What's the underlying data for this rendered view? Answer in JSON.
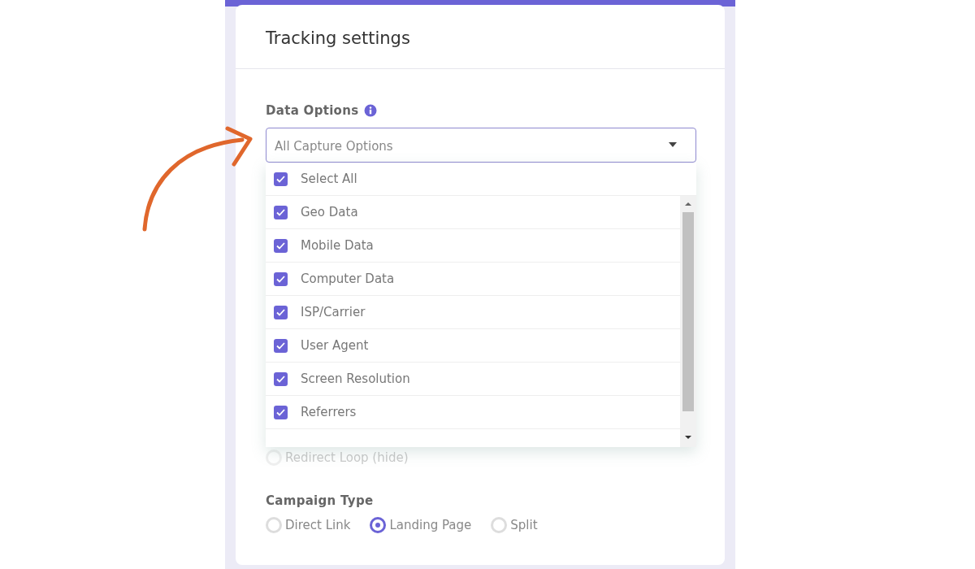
{
  "panel": {
    "title": "Tracking settings"
  },
  "data_options": {
    "label": "Data Options",
    "placeholder": "All Capture Options",
    "expanded": true,
    "select_all": {
      "label": "Select All",
      "checked": true
    },
    "options": [
      {
        "label": "Geo Data",
        "checked": true
      },
      {
        "label": "Mobile Data",
        "checked": true
      },
      {
        "label": "Computer Data",
        "checked": true
      },
      {
        "label": "ISP/Carrier",
        "checked": true
      },
      {
        "label": "User Agent",
        "checked": true
      },
      {
        "label": "Screen Resolution",
        "checked": true
      },
      {
        "label": "Referrers",
        "checked": true
      }
    ]
  },
  "redirect_option": {
    "label": "Redirect Loop (hide)",
    "selected": false
  },
  "campaign_type": {
    "label": "Campaign Type",
    "options": [
      {
        "label": "Direct Link",
        "selected": false
      },
      {
        "label": "Landing Page",
        "selected": true
      },
      {
        "label": "Split",
        "selected": false
      }
    ]
  }
}
